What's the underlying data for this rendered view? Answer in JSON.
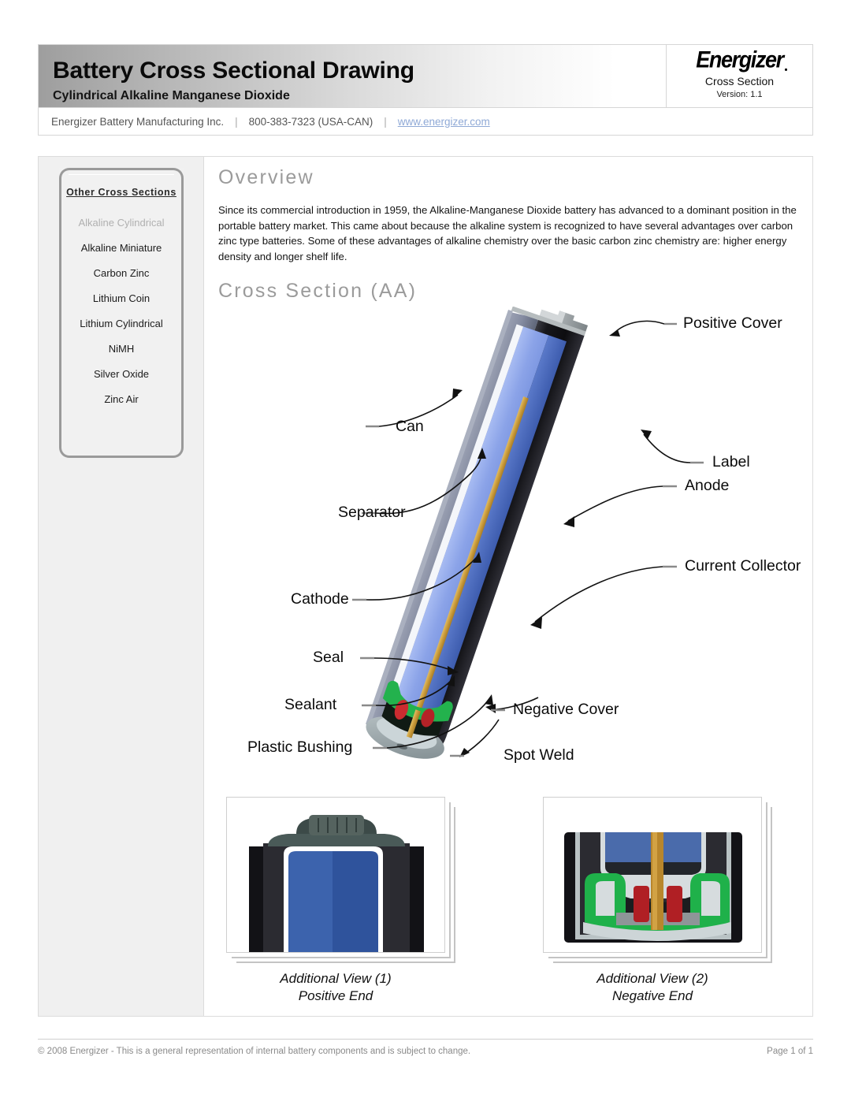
{
  "header": {
    "title": "Battery Cross Sectional Drawing",
    "subtitle": "Cylindrical Alkaline Manganese Dioxide",
    "logo_text": "Energizer",
    "logo_sub": "Cross Section",
    "logo_version": "Version: 1.1"
  },
  "contact": {
    "company": "Energizer Battery Manufacturing Inc.",
    "sep1": "|",
    "phone": "800-383-7323 (USA-CAN)",
    "sep2": "|",
    "website": "www.energizer.com"
  },
  "sidebar": {
    "heading": "Other Cross Sections",
    "items": [
      {
        "label": "Alkaline Cylindrical",
        "current": true
      },
      {
        "label": "Alkaline Miniature",
        "current": false
      },
      {
        "label": "Carbon Zinc",
        "current": false
      },
      {
        "label": "Lithium Coin",
        "current": false
      },
      {
        "label": "Lithium Cylindrical",
        "current": false
      },
      {
        "label": "NiMH",
        "current": false
      },
      {
        "label": "Silver Oxide",
        "current": false
      },
      {
        "label": "Zinc Air",
        "current": false
      }
    ]
  },
  "overview": {
    "heading": "Overview",
    "body": "Since its commercial introduction in 1959, the Alkaline-Manganese Dioxide battery has advanced to a dominant position in the portable battery market. This came about because the alkaline system is recognized to have several advantages over carbon zinc type batteries. Some of these advantages of alkaline chemistry over the basic carbon zinc chemistry are: higher energy density and longer shelf life."
  },
  "cross_section": {
    "heading": "Cross Section (AA)",
    "callouts": [
      {
        "name": "positive-cover",
        "label": "Positive Cover"
      },
      {
        "name": "can",
        "label": "Can"
      },
      {
        "name": "label",
        "label": "Label"
      },
      {
        "name": "separator",
        "label": "Separator"
      },
      {
        "name": "anode",
        "label": "Anode"
      },
      {
        "name": "cathode",
        "label": "Cathode"
      },
      {
        "name": "current-collector",
        "label": "Current Collector"
      },
      {
        "name": "seal",
        "label": "Seal"
      },
      {
        "name": "sealant",
        "label": "Sealant"
      },
      {
        "name": "negative-cover",
        "label": "Negative Cover"
      },
      {
        "name": "plastic-bushing",
        "label": "Plastic Bushing"
      },
      {
        "name": "spot-weld",
        "label": "Spot Weld"
      }
    ]
  },
  "additional_views": [
    {
      "title": "Additional View (1)",
      "subtitle": "Positive End"
    },
    {
      "title": "Additional View (2)",
      "subtitle": "Negative End"
    }
  ],
  "footer": {
    "copyright": "© 2008 Energizer - This is a general representation of internal battery components and is subject to change.",
    "page": "Page 1 of 1"
  },
  "colors": {
    "can_light": "#8d93a8",
    "can_mid": "#6f7689",
    "separator_white": "#f2f4f8",
    "cathode_blue": "#8fa6e8",
    "anode_blue": "#4a6bbd",
    "label_black": "#1b1b1f",
    "collector_gold": "#c89a3c",
    "seal_green": "#22b14c",
    "sealant_red": "#c1272d",
    "bushing_gray": "#c9d3d6",
    "link": "#8fa9d6",
    "heading_gray": "#9b9b9b"
  }
}
